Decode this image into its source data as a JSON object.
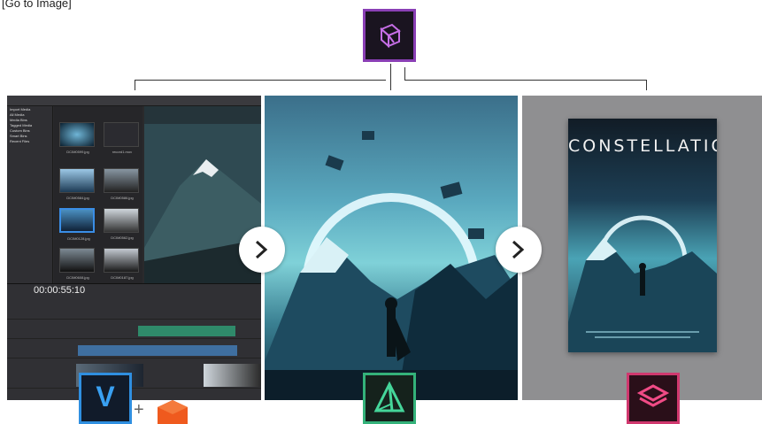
{
  "caption": "[Go to Image]",
  "top_icon": {
    "name": "3d-cube-app-icon",
    "border_color": "#8a3fb5"
  },
  "editor_panel": {
    "timecode": "00:00:55:10",
    "tree_items": [
      "Import Media",
      "All Media",
      "Media Bins",
      "Tagged Media",
      "Custom Bins",
      "Smart Bins",
      "Recent Files"
    ],
    "thumbnails": [
      {
        "label": "DCIM0599.jpg",
        "selected": false
      },
      {
        "label": "record1.mov",
        "selected": false
      },
      {
        "label": "DCIM0584.jpg",
        "selected": false
      },
      {
        "label": "DCIM0586.jpg",
        "selected": false
      },
      {
        "label": "DCIM0128.jpg",
        "selected": true
      },
      {
        "label": "DCIM0562.jpg",
        "selected": false
      },
      {
        "label": "DCIM0608.jpg",
        "selected": false
      },
      {
        "label": "DCIM0187.jpg",
        "selected": false
      }
    ]
  },
  "artwork_panel": {
    "description_tag": "artwork"
  },
  "poster_panel": {
    "poster_title": "CONSTELLATION"
  },
  "nav": {
    "next_icon": "chevron-right-icon"
  },
  "bottom_icons": {
    "v_icon_letter": "V",
    "plus_sign": "+",
    "v_icon_color": "#2f8fe0",
    "orange_icon_color": "#ef5a1e",
    "triangle_icon_color": "#34b27a",
    "layers_icon_color": "#d0386e"
  }
}
